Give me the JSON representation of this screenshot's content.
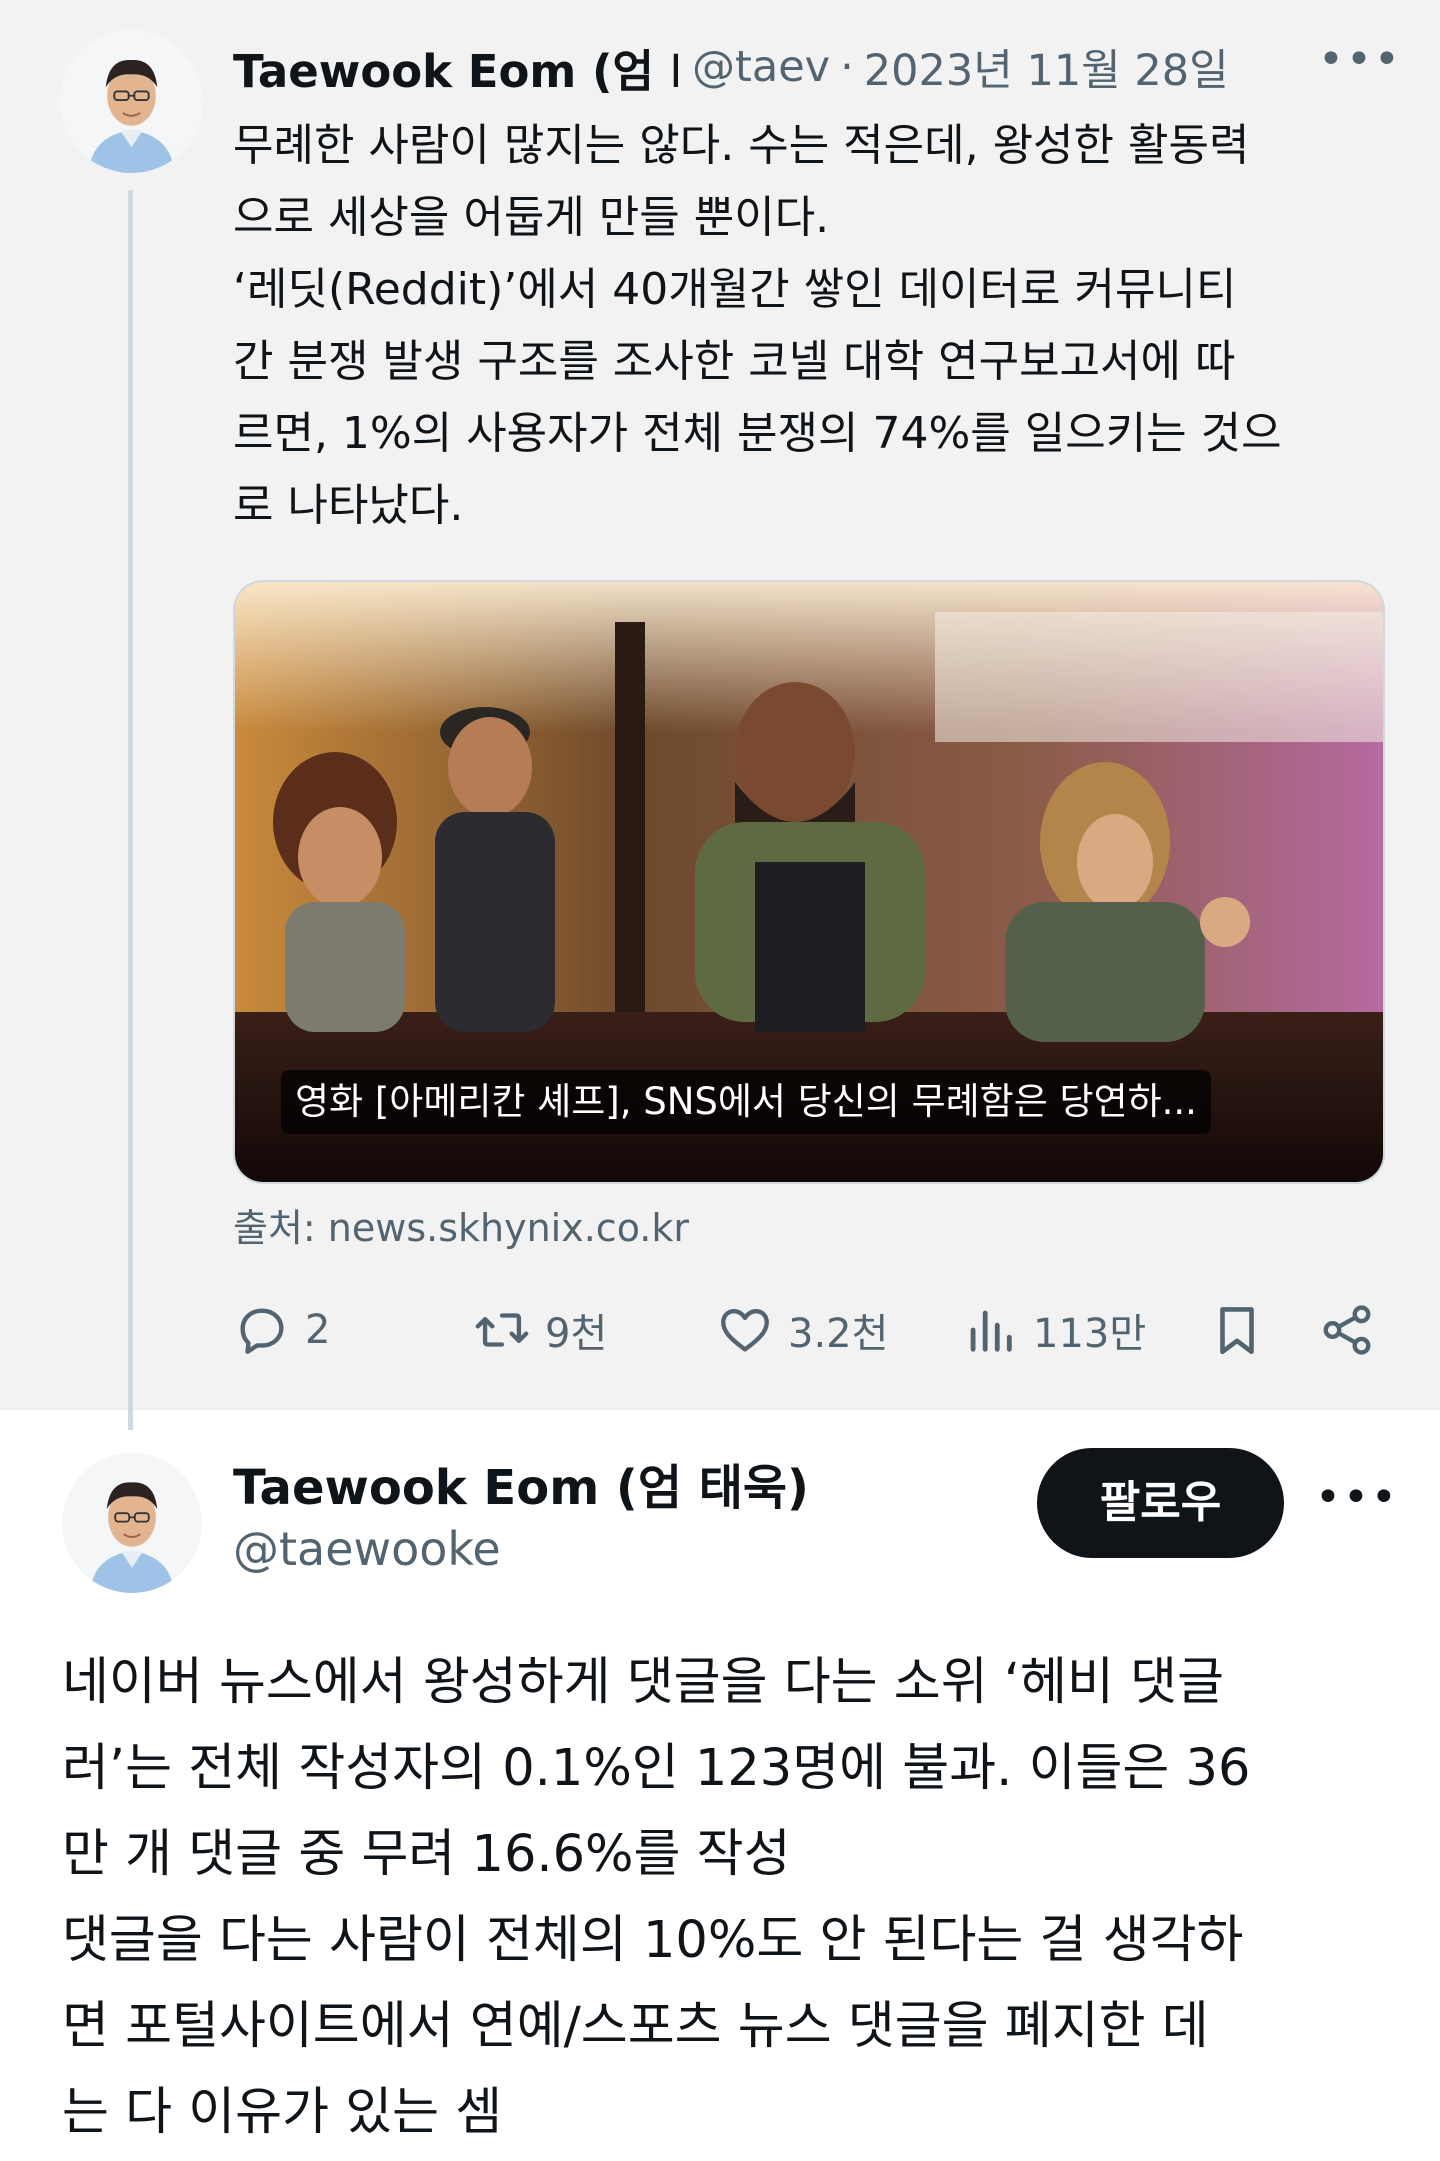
{
  "quoted_tweet": {
    "author_name": "Taewook Eom (엄 I",
    "handle": "@taev",
    "separator": "·",
    "date": "2023년 11월 28일",
    "more_icon": "more-horizontal-icon",
    "text": "무례한 사람이 많지는 않다. 수는 적은데, 왕성한 활동력\n으로 세상을 어둡게 만들 뿐이다.\n‘레딧(Reddit)’에서 40개월간 쌓인 데이터로 커뮤니티\n간 분쟁 발생 구조를 조사한 코넬 대학 연구보고서에 따\n르면, 1%의 사용자가 전체 분쟁의 74%를 일으키는 것으\n로 나타났다.",
    "link_card": {
      "caption": "영화 [아메리칸 셰프], SNS에서 당신의 무례함은 당연하...",
      "source": "출처: news.skhynix.co.kr"
    },
    "actions": {
      "replies": "2",
      "retweets": "9천",
      "likes": "3.2천",
      "views": "113만"
    }
  },
  "main_tweet": {
    "author_name": "Taewook Eom (엄 태욱)",
    "handle": "@taewooke",
    "follow_label": "팔로우",
    "text": "네이버 뉴스에서 왕성하게 댓글을 다는 소위 ‘헤비 댓글\n러’는 전체 작성자의 0.1%인 123명에 불과. 이들은 36\n만 개 댓글 중 무려 16.6%를 작성\n댓글을 다는 사람이 전체의 10%도 안 된다는 걸 생각하\n면 포털사이트에서 연예/스포츠 뉴스 댓글을 폐지한 데\n는 다 이유가 있는 셈"
  },
  "colors": {
    "text_primary": "#0f1419",
    "text_secondary": "#536471",
    "quoted_background": "#f2f2f2",
    "thread_line": "#cfd9de",
    "follow_button": "#0f1419"
  }
}
